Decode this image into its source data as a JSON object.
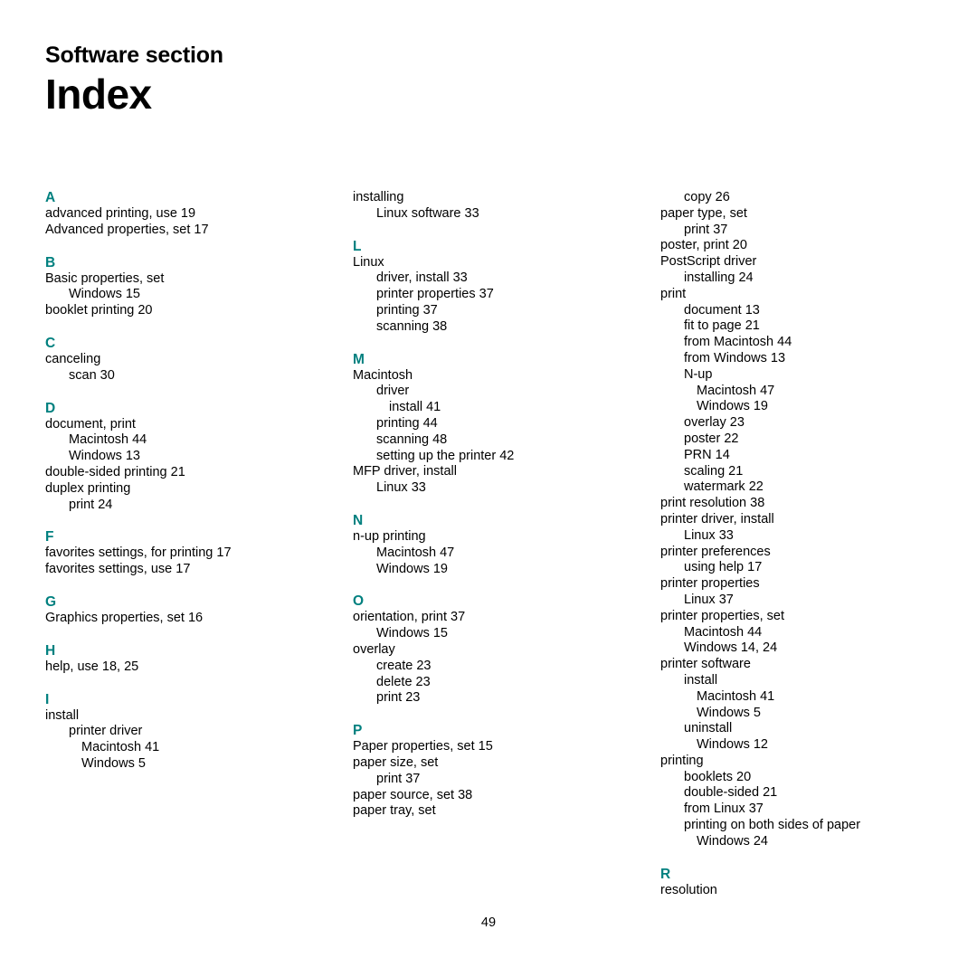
{
  "header": {
    "kicker": "Software section",
    "title": "Index"
  },
  "footer": {
    "page_number": "49"
  },
  "colors": {
    "section_letter": "#00807f",
    "text": "#000000",
    "background": "#ffffff"
  },
  "columns": [
    {
      "id": "column-1",
      "blocks": [
        {
          "letter": "A",
          "entries": [
            {
              "text": "advanced printing, use 19",
              "level": 0
            },
            {
              "text": "Advanced properties, set 17",
              "level": 0
            }
          ]
        },
        {
          "letter": "B",
          "entries": [
            {
              "text": "Basic properties, set",
              "level": 0
            },
            {
              "text": "Windows 15",
              "level": 1
            },
            {
              "text": "booklet printing 20",
              "level": 0
            }
          ]
        },
        {
          "letter": "C",
          "entries": [
            {
              "text": "canceling",
              "level": 0
            },
            {
              "text": "scan 30",
              "level": 1
            }
          ]
        },
        {
          "letter": "D",
          "entries": [
            {
              "text": "document, print",
              "level": 0
            },
            {
              "text": "Macintosh 44",
              "level": 1
            },
            {
              "text": "Windows 13",
              "level": 1
            },
            {
              "text": "double-sided printing 21",
              "level": 0
            },
            {
              "text": "duplex printing",
              "level": 0
            },
            {
              "text": "print 24",
              "level": 1
            }
          ]
        },
        {
          "letter": "F",
          "entries": [
            {
              "text": "favorites settings, for printing 17",
              "level": 0
            },
            {
              "text": "favorites settings, use 17",
              "level": 0
            }
          ]
        },
        {
          "letter": "G",
          "entries": [
            {
              "text": "Graphics properties, set 16",
              "level": 0
            }
          ]
        },
        {
          "letter": "H",
          "entries": [
            {
              "text": "help, use 18, 25",
              "level": 0
            }
          ]
        },
        {
          "letter": "I",
          "entries": [
            {
              "text": "install",
              "level": 0
            },
            {
              "text": "printer driver",
              "level": 1
            },
            {
              "text": "Macintosh 41",
              "level": 2
            },
            {
              "text": "Windows 5",
              "level": 2
            }
          ]
        }
      ]
    },
    {
      "id": "column-2",
      "blocks": [
        {
          "letter": "",
          "entries": [
            {
              "text": "installing",
              "level": 0
            },
            {
              "text": "Linux software 33",
              "level": 1
            }
          ]
        },
        {
          "letter": "L",
          "entries": [
            {
              "text": "Linux",
              "level": 0
            },
            {
              "text": "driver, install 33",
              "level": 1
            },
            {
              "text": "printer properties 37",
              "level": 1
            },
            {
              "text": "printing 37",
              "level": 1
            },
            {
              "text": "scanning 38",
              "level": 1
            }
          ]
        },
        {
          "letter": "M",
          "entries": [
            {
              "text": "Macintosh",
              "level": 0
            },
            {
              "text": "driver",
              "level": 1
            },
            {
              "text": "install 41",
              "level": 2
            },
            {
              "text": "printing 44",
              "level": 1
            },
            {
              "text": "scanning 48",
              "level": 1
            },
            {
              "text": "setting up the printer 42",
              "level": 1
            },
            {
              "text": "MFP driver, install",
              "level": 0
            },
            {
              "text": "Linux 33",
              "level": 1
            }
          ]
        },
        {
          "letter": "N",
          "entries": [
            {
              "text": "n-up printing",
              "level": 0
            },
            {
              "text": "Macintosh 47",
              "level": 1
            },
            {
              "text": "Windows 19",
              "level": 1
            }
          ]
        },
        {
          "letter": "O",
          "entries": [
            {
              "text": "orientation, print 37",
              "level": 0
            },
            {
              "text": "Windows 15",
              "level": 1
            },
            {
              "text": "overlay",
              "level": 0
            },
            {
              "text": "create 23",
              "level": 1
            },
            {
              "text": "delete 23",
              "level": 1
            },
            {
              "text": "print 23",
              "level": 1
            }
          ]
        },
        {
          "letter": "P",
          "entries": [
            {
              "text": "Paper properties, set 15",
              "level": 0
            },
            {
              "text": "paper size, set",
              "level": 0
            },
            {
              "text": "print 37",
              "level": 1
            },
            {
              "text": "paper source, set 38",
              "level": 0
            },
            {
              "text": "paper tray, set",
              "level": 0
            }
          ]
        }
      ]
    },
    {
      "id": "column-3",
      "blocks": [
        {
          "letter": "",
          "entries": [
            {
              "text": "copy 26",
              "level": 1
            },
            {
              "text": "paper type, set",
              "level": 0
            },
            {
              "text": "print 37",
              "level": 1
            },
            {
              "text": "poster, print 20",
              "level": 0
            },
            {
              "text": "PostScript driver",
              "level": 0
            },
            {
              "text": "installing 24",
              "level": 1
            },
            {
              "text": "print",
              "level": 0
            },
            {
              "text": "document 13",
              "level": 1
            },
            {
              "text": "fit to page 21",
              "level": 1
            },
            {
              "text": "from Macintosh 44",
              "level": 1
            },
            {
              "text": "from Windows 13",
              "level": 1
            },
            {
              "text": "N-up",
              "level": 1
            },
            {
              "text": "Macintosh 47",
              "level": 2
            },
            {
              "text": "Windows 19",
              "level": 2
            },
            {
              "text": "overlay 23",
              "level": 1
            },
            {
              "text": "poster 22",
              "level": 1
            },
            {
              "text": "PRN 14",
              "level": 1
            },
            {
              "text": "scaling 21",
              "level": 1
            },
            {
              "text": "watermark 22",
              "level": 1
            },
            {
              "text": "print resolution 38",
              "level": 0
            },
            {
              "text": "printer driver, install",
              "level": 0
            },
            {
              "text": "Linux 33",
              "level": 1
            },
            {
              "text": "printer preferences",
              "level": 0
            },
            {
              "text": "using help 17",
              "level": 1
            },
            {
              "text": "printer properties",
              "level": 0
            },
            {
              "text": "Linux 37",
              "level": 1
            },
            {
              "text": "printer properties, set",
              "level": 0
            },
            {
              "text": "Macintosh 44",
              "level": 1
            },
            {
              "text": "Windows 14, 24",
              "level": 1
            },
            {
              "text": "printer software",
              "level": 0
            },
            {
              "text": "install",
              "level": 1
            },
            {
              "text": "Macintosh 41",
              "level": 2
            },
            {
              "text": "Windows 5",
              "level": 2
            },
            {
              "text": "uninstall",
              "level": 1
            },
            {
              "text": "Windows 12",
              "level": 2
            },
            {
              "text": "printing",
              "level": 0
            },
            {
              "text": "booklets 20",
              "level": 1
            },
            {
              "text": "double-sided 21",
              "level": 1
            },
            {
              "text": "from Linux 37",
              "level": 1
            },
            {
              "text": "printing on both sides of paper",
              "level": 1
            },
            {
              "text": "Windows 24",
              "level": 2
            }
          ]
        },
        {
          "letter": "R",
          "entries": [
            {
              "text": "resolution",
              "level": 0
            }
          ]
        }
      ]
    }
  ]
}
